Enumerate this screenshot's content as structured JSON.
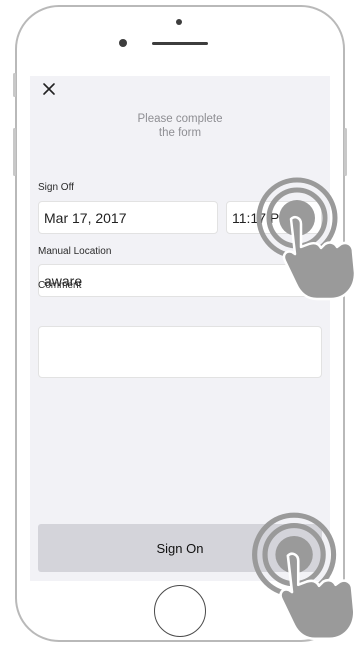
{
  "header": {
    "title": "Please complete\nthe form"
  },
  "sign_off": {
    "label": "Sign Off",
    "date": "Mar 17, 2017",
    "time": "11:17 PM"
  },
  "manual_location": {
    "label": "Manual Location",
    "value": "aware"
  },
  "comment": {
    "label": "Comment",
    "value": ""
  },
  "actions": {
    "submit_label": "Sign On"
  },
  "icons": {
    "close": "close-icon",
    "tap": "tap-gesture-icon"
  },
  "colors": {
    "screen_bg": "#f2f2f6",
    "button_bg": "#d4d4da",
    "gesture": "#9a9a9a"
  }
}
